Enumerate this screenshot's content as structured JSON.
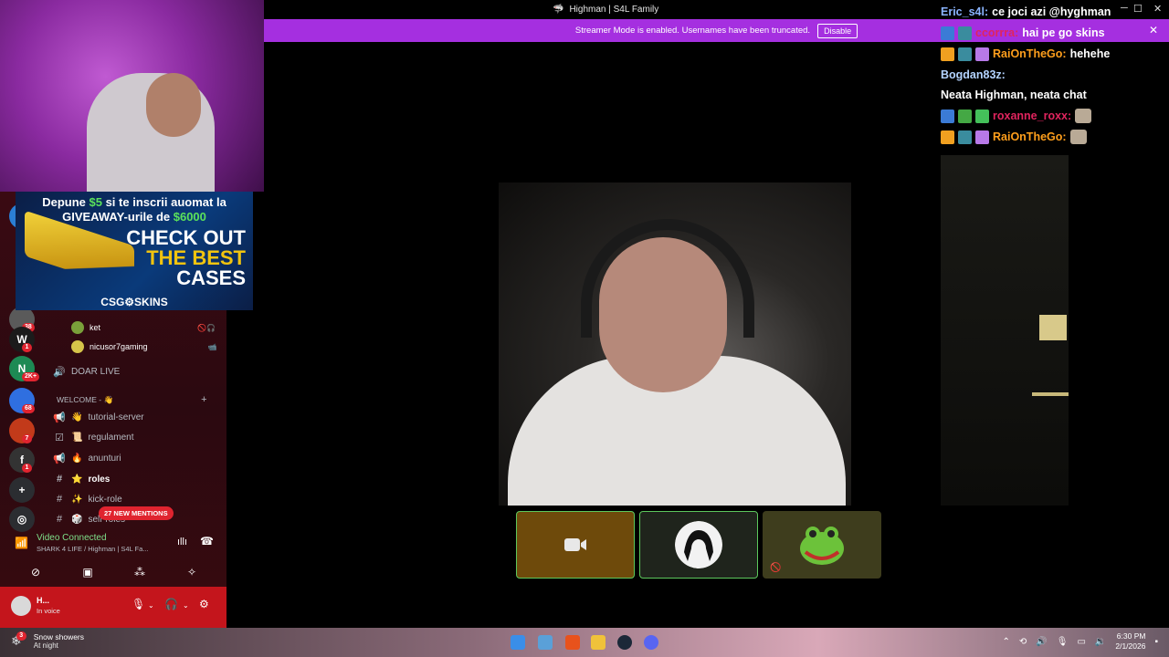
{
  "window": {
    "title": "Highman | S4L Family",
    "min": "─",
    "max": "☐",
    "close": "✕"
  },
  "banner": {
    "text": "Streamer Mode is enabled. Usernames have been truncated.",
    "button": "Disable",
    "close": "✕"
  },
  "ad": {
    "line1_a": "Depune ",
    "line1_amount": "$5",
    "line1_b": " si te inscrii auomat la",
    "line2_a": "GIVEAWAY-urile de ",
    "line2_amount": "$6000",
    "cta": [
      "CHECK OUT",
      "THE BEST",
      "CASES"
    ],
    "brand": "CSG⚙SKINS"
  },
  "servers": [
    {
      "label": "",
      "badge": "1",
      "color": "#2b7fd4"
    },
    {
      "label": "",
      "badge": "38",
      "color": "#5a5a5a"
    },
    {
      "label": "W",
      "badge": "1",
      "color": "#1b1b1b"
    },
    {
      "label": "N",
      "badge": "2K+",
      "color": "#1d8a54"
    },
    {
      "label": "",
      "badge": "68",
      "color": "#2f6fe0"
    },
    {
      "label": "",
      "badge": "7",
      "color": "#c23a1a"
    },
    {
      "label": "f",
      "badge": "1",
      "color": "#333"
    },
    {
      "label": "+",
      "badge": "",
      "color": "#2b2d31"
    },
    {
      "label": "◎",
      "badge": "",
      "color": "#2b2d31"
    }
  ],
  "voice_users": [
    {
      "name": "ket",
      "right": "🚫🎧"
    },
    {
      "name": "nicusor7gaming",
      "right": "📹"
    }
  ],
  "channels": {
    "doar_live": "DOAR LIVE",
    "category": "WELCOME - 👋",
    "list": [
      {
        "emoji": "👋",
        "name": "tutorial-server",
        "bold": false
      },
      {
        "emoji": "📜",
        "name": "regulament",
        "bold": false
      },
      {
        "emoji": "🔥",
        "name": "anunturi",
        "bold": false
      },
      {
        "emoji": "⭐",
        "name": "roles",
        "bold": true
      },
      {
        "emoji": "✨",
        "name": "kick-role",
        "bold": false
      },
      {
        "emoji": "🎲",
        "name": "self-roles",
        "bold": false
      }
    ]
  },
  "mentions": "27 NEW MENTIONS",
  "voice": {
    "status": "Video Connected",
    "channel": "SHARK 4 LIFE / Highman | S4L Fa..."
  },
  "user": {
    "name": "H...",
    "status": "In voice"
  },
  "chat": [
    {
      "user": "Eric_s4l:",
      "user_color": "#8ab4ff",
      "text": "ce joci azi @hyghman",
      "badges": [],
      "emote": false
    },
    {
      "user": "ccorrra:",
      "user_color": "#e0245e",
      "text": "hai pe go skins",
      "badges": [
        "#3b7bd6",
        "#3a8c9e"
      ],
      "emote": false
    },
    {
      "user": "RaiOnTheGo:",
      "user_color": "#ff9f1c",
      "text": "hehehe",
      "badges": [
        "#f0a020",
        "#3a8c9e",
        "#b779e8"
      ],
      "emote": false
    },
    {
      "user": "Bogdan83z:",
      "user_color": "#b3d3ff",
      "text": "Neata Highman, neata chat",
      "badges": [],
      "emote": false
    },
    {
      "user": "roxanne_roxx:",
      "user_color": "#e0245e",
      "text": "",
      "badges": [
        "#3b7bd6",
        "#44a844",
        "#44c05a"
      ],
      "emote": true
    },
    {
      "user": "RaiOnTheGo:",
      "user_color": "#ff9f1c",
      "text": "",
      "badges": [
        "#f0a020",
        "#3a8c9e",
        "#b779e8"
      ],
      "emote": true
    }
  ],
  "taskbar": {
    "weather_line1": "Snow showers",
    "weather_line2": "At night",
    "weather_badge": "3",
    "time": "6:30 PM",
    "date": "2/1/2026"
  }
}
